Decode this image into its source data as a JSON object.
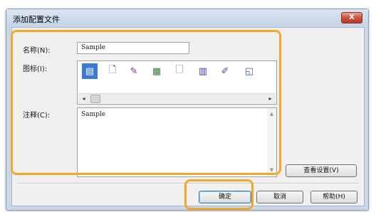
{
  "dialog": {
    "title": "添加配置文件",
    "close_label": "X"
  },
  "form": {
    "name_label": "名称(N):",
    "name_value": "Sample",
    "icon_label": "图标(I):",
    "comment_label": "注释(C):",
    "comment_value": "Sample"
  },
  "icons": [
    {
      "name": "page-icon",
      "glyph": "▤",
      "color": "#ffffff",
      "selected": true
    },
    {
      "name": "page-icon-2",
      "glyph": "🗋",
      "color": "#3b3b8a",
      "selected": false
    },
    {
      "name": "pen-page-icon",
      "glyph": "✎",
      "color": "#8a2bb0",
      "selected": false
    },
    {
      "name": "image-icon",
      "glyph": "▦",
      "color": "#2f7d3a",
      "selected": false
    },
    {
      "name": "note-icon",
      "glyph": "🗌",
      "color": "#33337a",
      "selected": false
    },
    {
      "name": "layout-icon",
      "glyph": "▥",
      "color": "#3a3aa8",
      "selected": false
    },
    {
      "name": "edit-icon",
      "glyph": "✐",
      "color": "#6a3aa8",
      "selected": false
    },
    {
      "name": "chart-icon",
      "glyph": "◱",
      "color": "#3a5aa8",
      "selected": false
    }
  ],
  "buttons": {
    "view_settings": "查看设置(V)",
    "ok": "确定",
    "cancel": "取消",
    "help": "帮助(H)"
  },
  "colors": {
    "highlight": "#f3a72c",
    "selection": "#3b7ad8"
  }
}
